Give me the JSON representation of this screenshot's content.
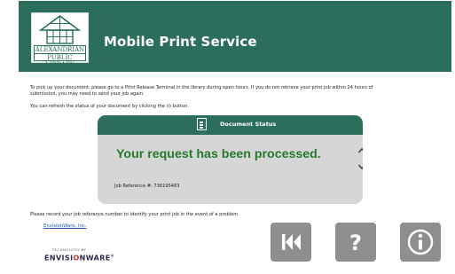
{
  "header": {
    "logo_line1": "ALEXANDRIAN",
    "logo_line2": "PUBLIC LIBRARY",
    "title": "Mobile Print Service"
  },
  "instructions": {
    "line1": "To pick up your document, please go to a Print Release Terminal in the library during open hours. If you do not retrieve your print job within 24 hours of",
    "line2": "submission, you may need to send your job again.",
    "line3": "You can refresh the status of your document by clicking the (i) button."
  },
  "status_panel": {
    "heading": "Document Status",
    "message": "Your request has been processed.",
    "reference_label": "Job Reference #:",
    "reference_number": "736195483",
    "icon": "document-icon"
  },
  "footer": {
    "note": "Please record your job reference number to identify your print job in the event of a problem.",
    "vendor_link": "EnvisionWare, Inc.",
    "technology_by": "TECHNOLOGY BY",
    "brand_part1": "ENVISI",
    "brand_part2": "O",
    "brand_part3": "NWARE",
    "brand_mark": "®"
  },
  "nav": {
    "back_icon": "skip-back-icon",
    "help_icon": "question-mark-icon",
    "help_glyph": "?",
    "info_icon": "info-icon"
  },
  "colors": {
    "brand_green": "#2b6e5c",
    "panel_gray": "#d6d6d6",
    "status_green": "#257a2d",
    "button_gray": "#8e8e8e"
  }
}
